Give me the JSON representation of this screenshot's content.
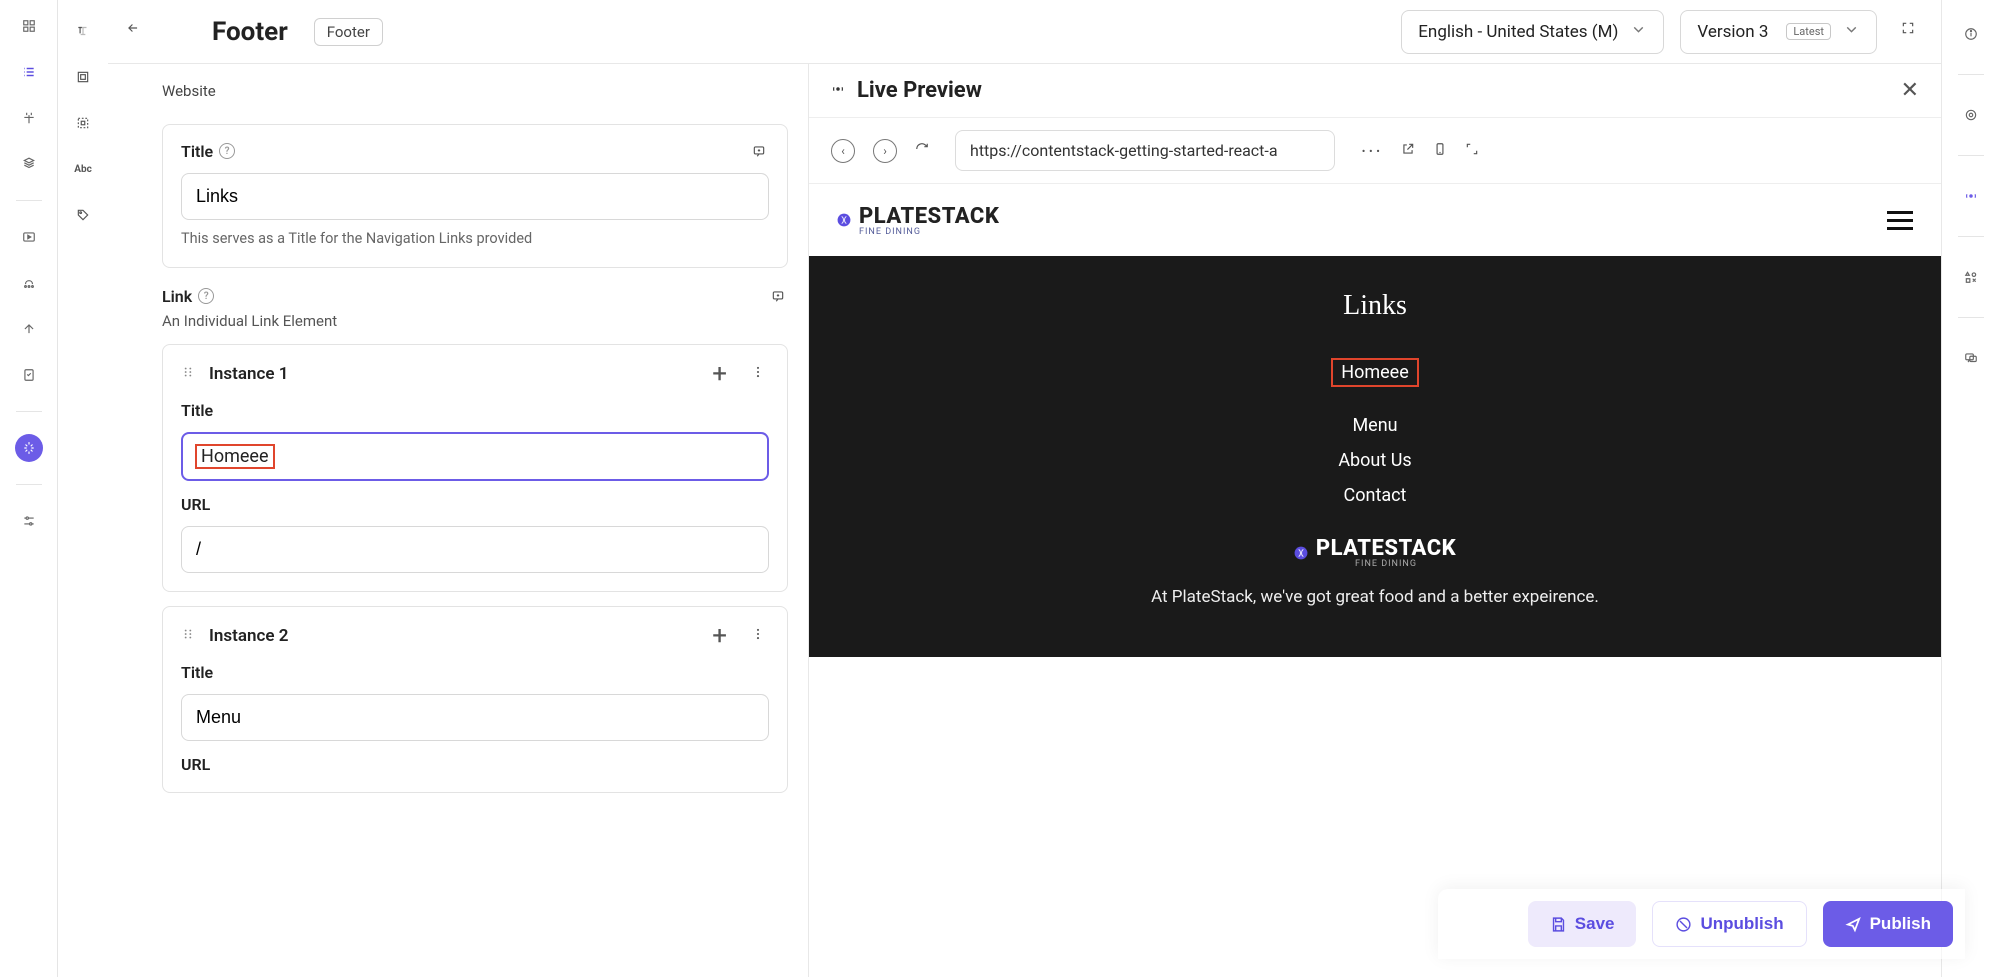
{
  "header": {
    "page_title": "Footer",
    "tag": "Footer",
    "locale": "English - United States (M)",
    "version": "Version 3",
    "latest_badge": "Latest"
  },
  "form": {
    "section_sub": "Website",
    "title_label": "Title",
    "title_value": "Links",
    "title_hint": "This serves as a Title for the Navigation Links provided",
    "link_label": "Link",
    "link_hint": "An Individual Link Element",
    "instances": [
      {
        "name": "Instance 1",
        "title_label": "Title",
        "title_value": "Homeee",
        "url_label": "URL",
        "url_value": "/"
      },
      {
        "name": "Instance 2",
        "title_label": "Title",
        "title_value": "Menu",
        "url_label": "URL",
        "url_value": ""
      }
    ]
  },
  "preview": {
    "title": "Live Preview",
    "url": "https://contentstack-getting-started-react-a",
    "site": {
      "brand": "PLATESTACK",
      "brand_sub": "FINE DINING",
      "links_heading": "Links",
      "links": [
        "Homeee",
        "Menu",
        "About Us",
        "Contact"
      ],
      "tagline": "At PlateStack, we've got great food and a better expeirence."
    }
  },
  "actions": {
    "save": "Save",
    "unpublish": "Unpublish",
    "publish": "Publish"
  }
}
